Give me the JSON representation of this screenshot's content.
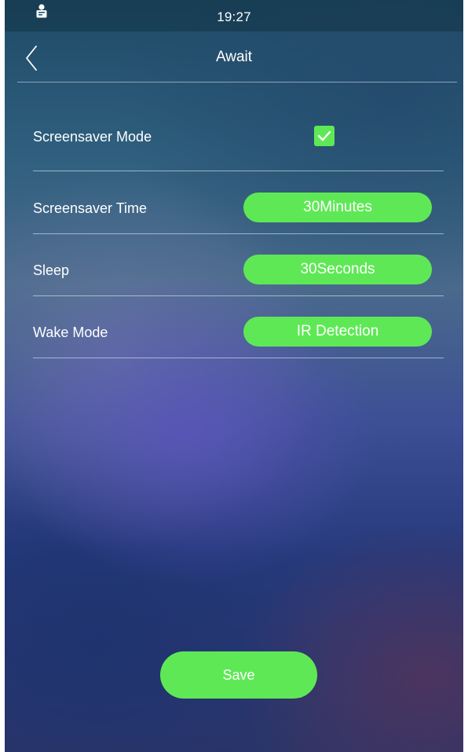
{
  "status_bar": {
    "time": "19:27",
    "user_icon": "user-icon"
  },
  "header": {
    "title": "Await",
    "back_icon": "chevron-left-icon"
  },
  "settings": {
    "screensaver_mode": {
      "label": "Screensaver Mode",
      "checked": true
    },
    "screensaver_time": {
      "label": "Screensaver Time",
      "value": "30Minutes"
    },
    "sleep": {
      "label": "Sleep",
      "value": "30Seconds"
    },
    "wake_mode": {
      "label": "Wake Mode",
      "value": "IR Detection"
    }
  },
  "footer": {
    "save_label": "Save"
  },
  "colors": {
    "accent_green": "#5fe856",
    "text": "#ffffff"
  }
}
